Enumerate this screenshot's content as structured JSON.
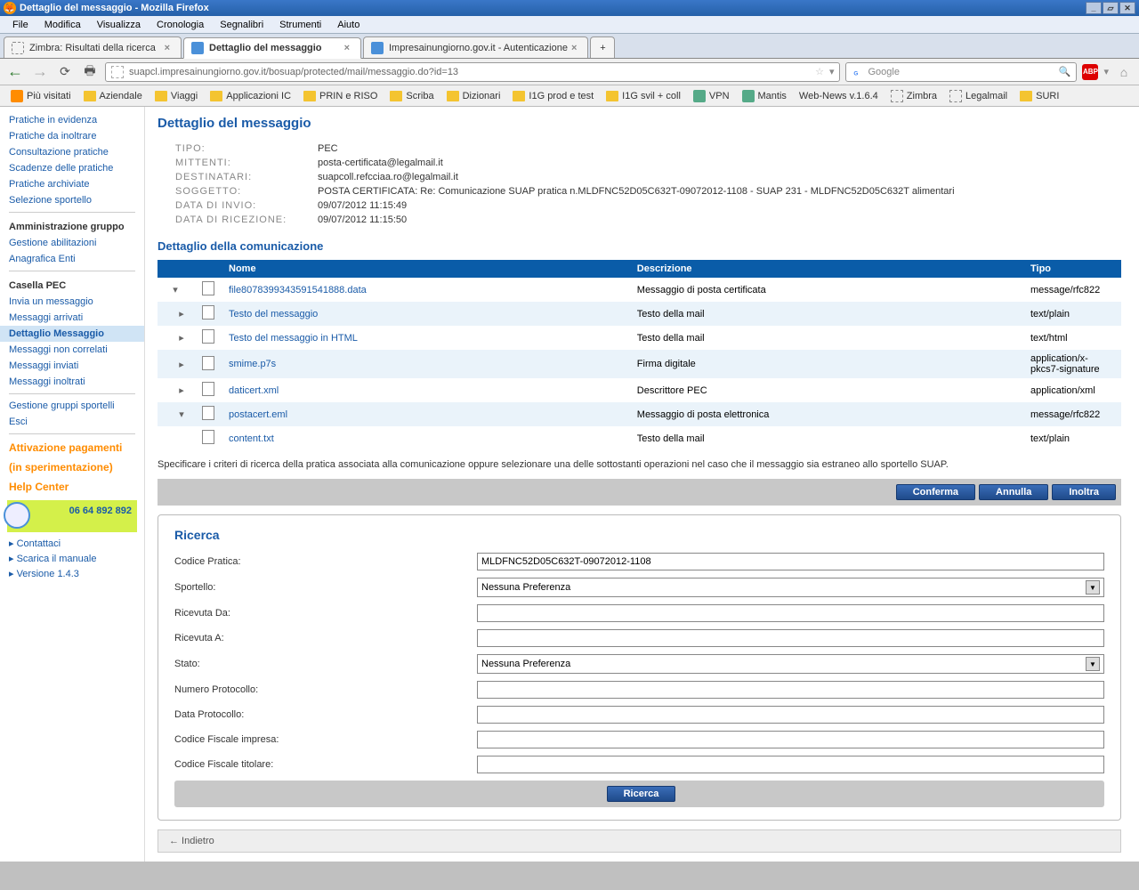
{
  "window_title": "Dettaglio del messaggio - Mozilla Firefox",
  "menu": [
    "File",
    "Modifica",
    "Visualizza",
    "Cronologia",
    "Segnalibri",
    "Strumenti",
    "Aiuto"
  ],
  "tabs": [
    {
      "label": "Zimbra: Risultati della ricerca"
    },
    {
      "label": "Dettaglio del messaggio"
    },
    {
      "label": "Impresainungiorno.gov.it - Autenticazione"
    }
  ],
  "url": "suapcl.impresainungiorno.gov.it/bosuap/protected/mail/messaggio.do?id=13",
  "search_placeholder": "Google",
  "bookmarks": [
    "Più visitati",
    "Aziendale",
    "Viaggi",
    "Applicazioni IC",
    "PRIN e RISO",
    "Scriba",
    "Dizionari",
    "I1G prod e test",
    "I1G svil + coll",
    "VPN",
    "Mantis",
    "Web-News v.1.6.4",
    "Zimbra",
    "Legalmail",
    "SURI"
  ],
  "sidebar": {
    "nav": [
      "Pratiche in evidenza",
      "Pratiche da inoltrare",
      "Consultazione pratiche",
      "Scadenze delle pratiche",
      "Pratiche archiviate",
      "Selezione sportello"
    ],
    "admin_h": "Amministrazione gruppo",
    "admin": [
      "Gestione abilitazioni",
      "Anagrafica Enti"
    ],
    "pec_h": "Casella PEC",
    "pec": [
      "Invia un messaggio",
      "Messaggi arrivati",
      "Dettaglio Messaggio",
      "Messaggi non correlati",
      "Messaggi inviati",
      "Messaggi inoltrati"
    ],
    "foot": [
      "Gestione gruppi sportelli",
      "Esci"
    ],
    "promo1": "Attivazione pagamenti",
    "promo2": "(in sperimentazione)",
    "hc": "Help Center",
    "phone": "06 64 892 892",
    "links": [
      "Contattaci",
      "Scarica il manuale",
      "Versione 1.4.3"
    ]
  },
  "detail": {
    "title": "Dettaglio del messaggio",
    "rows": [
      {
        "l": "TIPO:",
        "v": "PEC"
      },
      {
        "l": "MITTENTI:",
        "v": "posta-certificata@legalmail.it"
      },
      {
        "l": "DESTINATARI:",
        "v": "suapcoll.refcciaa.ro@legalmail.it"
      },
      {
        "l": "SOGGETTO:",
        "v": "POSTA CERTIFICATA: Re: Comunicazione SUAP pratica n.MLDFNC52D05C632T-09072012-1108 - SUAP 231 - MLDFNC52D05C632T alimentari"
      },
      {
        "l": "DATA DI INVIO:",
        "v": "09/07/2012 11:15:49"
      },
      {
        "l": "DATA DI RICEZIONE:",
        "v": "09/07/2012 11:15:50"
      }
    ],
    "subt": "Dettaglio della comunicazione",
    "thead": [
      "Nome",
      "Descrizione",
      "Tipo"
    ],
    "files": [
      {
        "exp": "▾",
        "name": "file8078399343591541888.data",
        "desc": "Messaggio di posta certificata",
        "type": "message/rfc822",
        "ind": 0
      },
      {
        "exp": "▸",
        "name": "Testo del messaggio",
        "desc": "Testo della mail",
        "type": "text/plain",
        "ind": 1
      },
      {
        "exp": "▸",
        "name": "Testo del messaggio in HTML",
        "desc": "Testo della mail",
        "type": "text/html",
        "ind": 1
      },
      {
        "exp": "▸",
        "name": "smime.p7s",
        "desc": "Firma digitale",
        "type": "application/x-pkcs7-signature",
        "ind": 1
      },
      {
        "exp": "▸",
        "name": "daticert.xml",
        "desc": "Descrittore PEC",
        "type": "application/xml",
        "ind": 1
      },
      {
        "exp": "▾",
        "name": "postacert.eml",
        "desc": "Messaggio di posta elettronica",
        "type": "message/rfc822",
        "ind": 1
      },
      {
        "exp": "",
        "name": "content.txt",
        "desc": "Testo della mail",
        "type": "text/plain",
        "ind": 2
      }
    ],
    "note": "Specificare i criteri di ricerca della pratica associata alla comunicazione oppure selezionare una delle sottostanti operazioni nel caso che il messaggio sia estraneo allo sportello SUAP.",
    "btns": [
      "Conferma",
      "Annulla",
      "Inoltra"
    ]
  },
  "ricerca": {
    "title": "Ricerca",
    "fields": [
      {
        "l": "Codice Pratica:",
        "v": "MLDFNC52D05C632T-09072012-1108",
        "t": "text"
      },
      {
        "l": "Sportello:",
        "v": "Nessuna Preferenza",
        "t": "sel"
      },
      {
        "l": "Ricevuta Da:",
        "v": "",
        "t": "text"
      },
      {
        "l": "Ricevuta A:",
        "v": "",
        "t": "text"
      },
      {
        "l": "Stato:",
        "v": "Nessuna Preferenza",
        "t": "sel"
      },
      {
        "l": "Numero Protocollo:",
        "v": "",
        "t": "text"
      },
      {
        "l": "Data Protocollo:",
        "v": "",
        "t": "text"
      },
      {
        "l": "Codice Fiscale impresa:",
        "v": "",
        "t": "text"
      },
      {
        "l": "Codice Fiscale titolare:",
        "v": "",
        "t": "text"
      }
    ],
    "btn": "Ricerca"
  },
  "back": "← Indietro"
}
